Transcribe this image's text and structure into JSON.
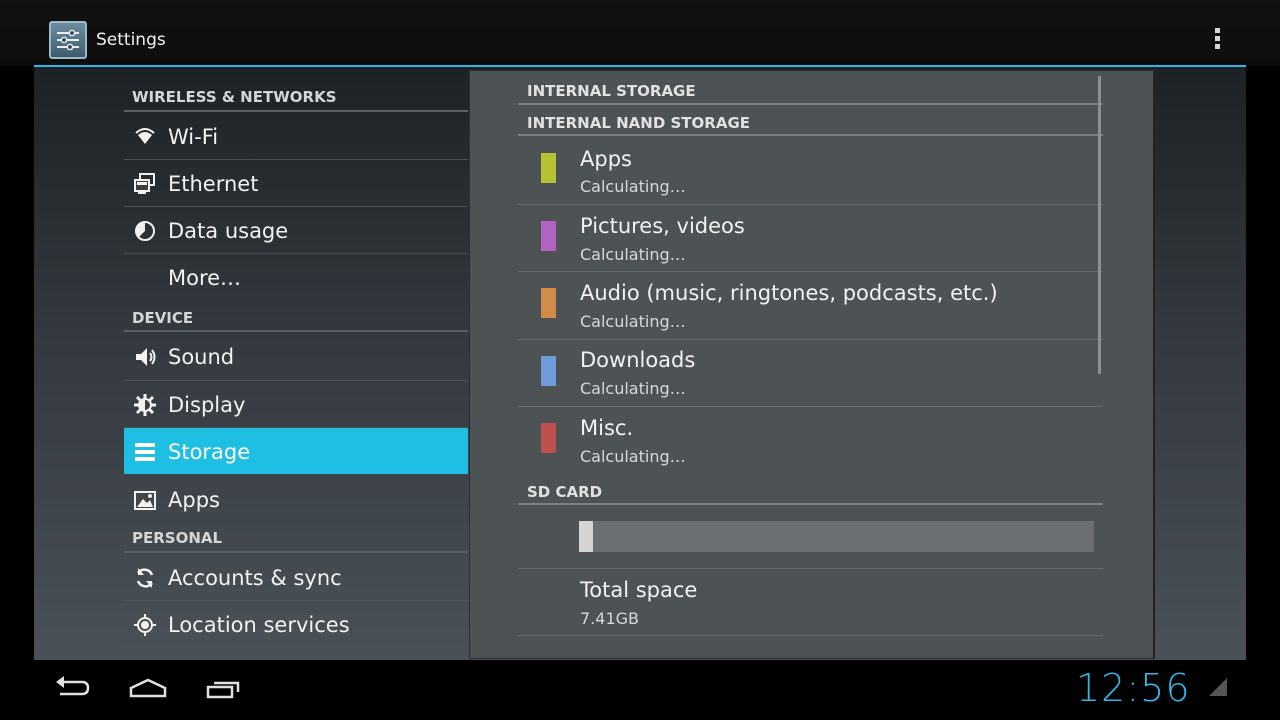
{
  "header": {
    "title": "Settings"
  },
  "sidebar": {
    "sections": [
      {
        "label": "WIRELESS & NETWORKS"
      },
      {
        "label": "DEVICE"
      },
      {
        "label": "PERSONAL"
      }
    ],
    "items": [
      {
        "label": "Wi-Fi",
        "icon": "wifi-icon"
      },
      {
        "label": "Ethernet",
        "icon": "ethernet-icon"
      },
      {
        "label": "Data usage",
        "icon": "data-usage-icon"
      },
      {
        "label": "More…",
        "icon": ""
      },
      {
        "label": "Sound",
        "icon": "sound-icon"
      },
      {
        "label": "Display",
        "icon": "display-icon"
      },
      {
        "label": "Storage",
        "icon": "storage-icon",
        "selected": true
      },
      {
        "label": "Apps",
        "icon": "apps-icon"
      },
      {
        "label": "Accounts & sync",
        "icon": "sync-icon"
      },
      {
        "label": "Location services",
        "icon": "location-icon"
      }
    ]
  },
  "storage": {
    "sections": {
      "internal": "INTERNAL STORAGE",
      "nand": "INTERNAL NAND STORAGE",
      "sd": "SD CARD"
    },
    "items": [
      {
        "title": "Apps",
        "status": "Calculating…",
        "color": "#b5c232"
      },
      {
        "title": "Pictures, videos",
        "status": "Calculating…",
        "color": "#b263c4"
      },
      {
        "title": "Audio (music, ringtones, podcasts, etc.)",
        "status": "Calculating…",
        "color": "#d18c4a"
      },
      {
        "title": "Downloads",
        "status": "Calculating…",
        "color": "#6f9bd8"
      },
      {
        "title": "Misc.",
        "status": "Calculating…",
        "color": "#c0504d"
      }
    ],
    "sd_usage_fraction": 0.027,
    "total_space": {
      "title": "Total space",
      "value": "7.41GB"
    }
  },
  "status_bar": {
    "clock": "12:56"
  },
  "colors": {
    "accent": "#33b5e5",
    "selected": "#1ebfe3"
  }
}
